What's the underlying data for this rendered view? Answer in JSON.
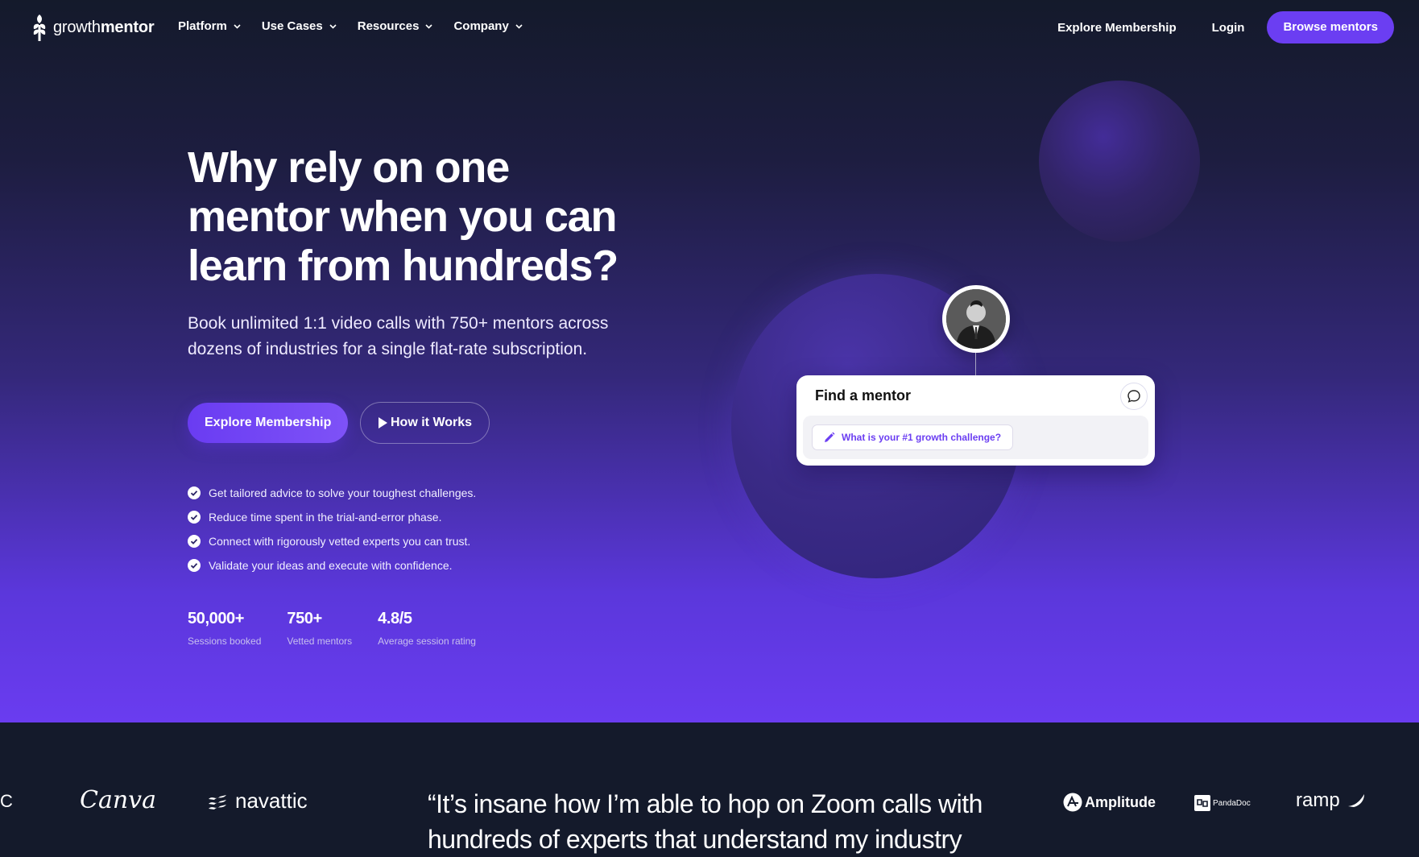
{
  "nav": {
    "logo_light": "growth",
    "logo_bold": "mentor",
    "menu": [
      {
        "label": "Platform"
      },
      {
        "label": "Use Cases"
      },
      {
        "label": "Resources"
      },
      {
        "label": "Company"
      }
    ],
    "explore_label": "Explore Membership",
    "login_label": "Login",
    "browse_label": "Browse mentors"
  },
  "hero": {
    "title": "Why rely on one mentor when you can learn from hundreds?",
    "subtitle": "Book unlimited 1:1 video calls with 750+ mentors across dozens of industries for a single flat-rate subscription.",
    "cta_primary": "Explore Membership",
    "cta_secondary": "How it Works",
    "benefits": [
      "Get tailored advice to solve your toughest challenges.",
      "Reduce time spent in the trial-and-error phase.",
      "Connect with rigorously vetted experts you can trust.",
      "Validate your ideas and execute with confidence."
    ],
    "stats": [
      {
        "value": "50,000+",
        "label": "Sessions booked"
      },
      {
        "value": "750+",
        "label": "Vetted mentors"
      },
      {
        "value": "4.8/5",
        "label": "Average session rating"
      }
    ]
  },
  "card": {
    "title": "Find a mentor",
    "prompt": "What is your #1 growth challenge?"
  },
  "strip": {
    "logos": [
      "C",
      "Canva",
      "navattic",
      "Amplitude",
      "PandaDoc",
      "ramp"
    ],
    "quote": "“It’s insane how I’m able to hop on Zoom calls with hundreds of experts that understand my industry"
  },
  "colors": {
    "accent": "#6b3ef2",
    "navy": "#141a2b"
  }
}
